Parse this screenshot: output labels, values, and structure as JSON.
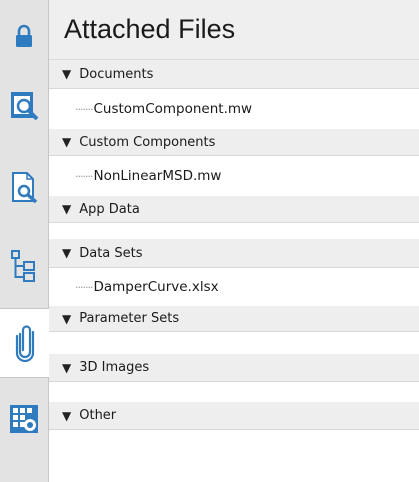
{
  "sidebar": {
    "buttons": [
      {
        "icon": "lock-icon"
      },
      {
        "icon": "inspector-icon"
      },
      {
        "icon": "document-search-icon"
      },
      {
        "icon": "tree-icon"
      },
      {
        "icon": "paperclip-icon"
      },
      {
        "icon": "component-grid-icon"
      }
    ]
  },
  "header": {
    "title": "Attached Files"
  },
  "sections": [
    {
      "label": "Documents",
      "items": [
        "CustomComponent.mw"
      ]
    },
    {
      "label": "Custom Components",
      "items": [
        "NonLinearMSD.mw"
      ]
    },
    {
      "label": "App Data",
      "items": []
    },
    {
      "label": "Data Sets",
      "items": [
        "DamperCurve.xlsx"
      ]
    },
    {
      "label": "Parameter Sets",
      "items": []
    },
    {
      "label": "3D Images",
      "items": []
    },
    {
      "label": "Other",
      "items": []
    }
  ],
  "glyphs": {
    "triangle": "▼",
    "tree_dots": "·······"
  },
  "colors": {
    "accent_blue": "#2e7bbf",
    "sidebar_bg": "#e3e3e3",
    "header_bg": "#efefef"
  }
}
